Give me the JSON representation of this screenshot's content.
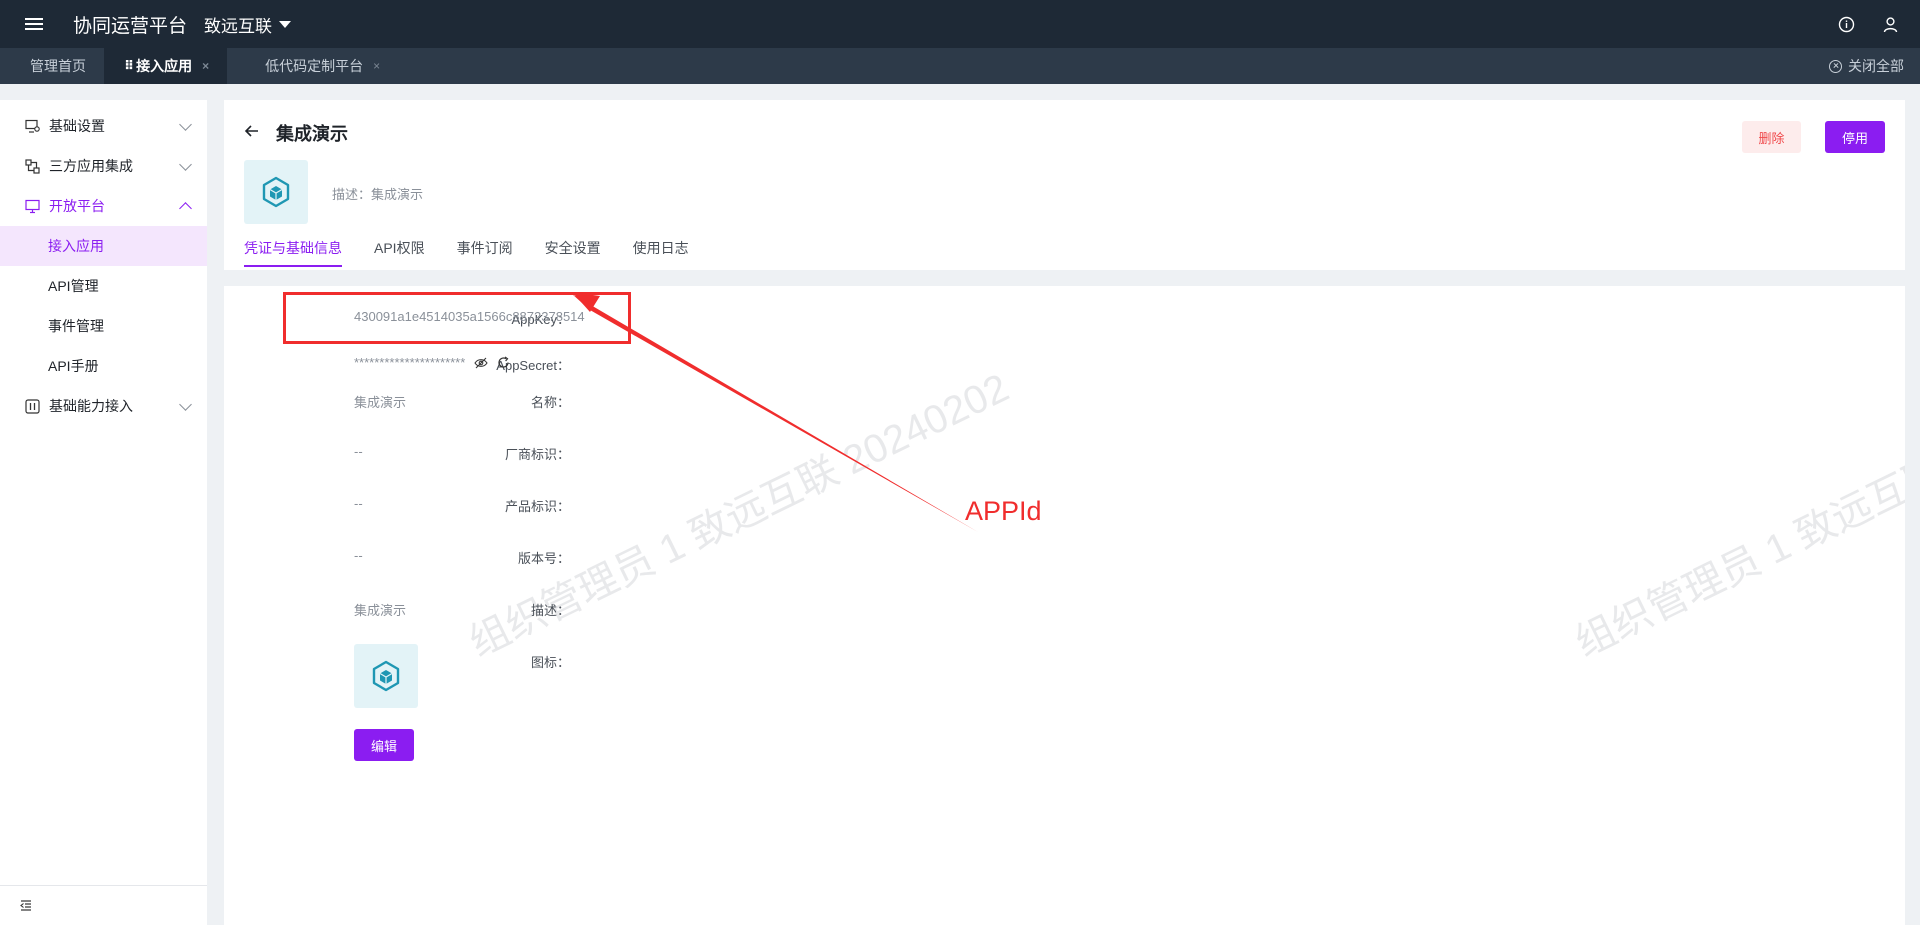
{
  "topbar": {
    "title": "协同运营平台",
    "org": "致远互联"
  },
  "tabs": [
    {
      "label": "管理首页"
    },
    {
      "label": "接入应用",
      "close": "×"
    },
    {
      "label": "低代码定制平台",
      "close": "×"
    }
  ],
  "close_all": "关闭全部",
  "sidebar": {
    "items": [
      {
        "label": "基础设置"
      },
      {
        "label": "三方应用集成"
      },
      {
        "label": "开放平台"
      },
      {
        "label": "接入应用"
      },
      {
        "label": "API管理"
      },
      {
        "label": "事件管理"
      },
      {
        "label": "API手册"
      },
      {
        "label": "基础能力接入"
      }
    ]
  },
  "header": {
    "title": "集成演示",
    "description": "描述：集成演示",
    "delete_label": "删除",
    "disable_label": "停用",
    "tabs": [
      "凭证与基础信息",
      "API权限",
      "事件订阅",
      "安全设置",
      "使用日志"
    ]
  },
  "details": {
    "appkey_label": "AppKey：",
    "appkey_value": "430091a1e4514035a1566c8872378514",
    "appsecret_label": "AppSecret：",
    "appsecret_value": "**********************",
    "name_label": "名称：",
    "name_value": "集成演示",
    "vendor_label": "厂商标识：",
    "vendor_value": "--",
    "product_label": "产品标识：",
    "product_value": "--",
    "version_label": "版本号：",
    "version_value": "--",
    "desc_label": "描述：",
    "desc_value": "集成演示",
    "icon_label": "图标：",
    "edit_label": "编辑"
  },
  "watermark": "组织管理员 1 致远互联 20240202",
  "annotation": {
    "label": "APPId",
    "color": "#f02d2d"
  },
  "colors": {
    "accent": "#8b1df1",
    "topbar": "#1e2936",
    "tabbar": "#2d3a49",
    "danger": "#f0494b",
    "icon_teal": "#1f97b3"
  },
  "icons": [
    "menu-icon",
    "info-icon",
    "user-icon",
    "close-circle-icon",
    "monitor-gear-icon",
    "app-link-icon",
    "screen-icon",
    "ability-icon",
    "collapse-icon",
    "back-arrow-icon",
    "cube-icon",
    "eye-off-icon",
    "refresh-icon"
  ]
}
